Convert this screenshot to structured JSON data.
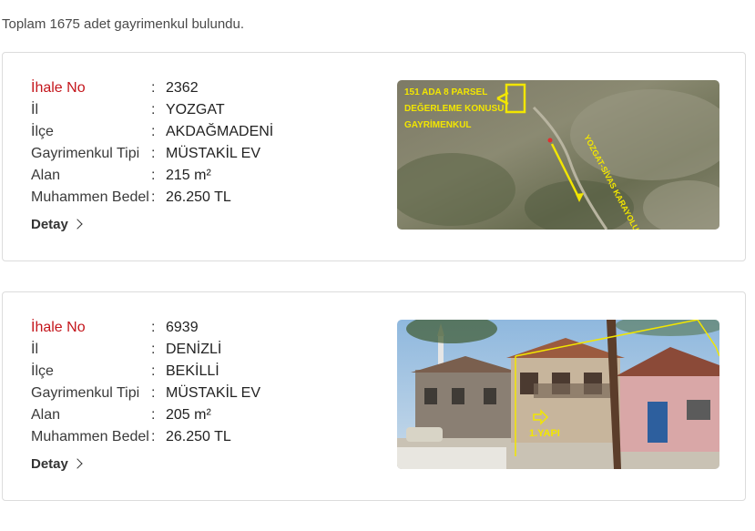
{
  "summary": "Toplam 1675 adet gayrimenkul bulundu.",
  "labels": {
    "ihale_no": "İhale No",
    "il": "İl",
    "ilce": "İlçe",
    "tip": "Gayrimenkul Tipi",
    "alan": "Alan",
    "bedel": "Muhammen Bedel",
    "colon": ":",
    "detail": "Detay"
  },
  "listings": [
    {
      "ihale_no": "2362",
      "il": "YOZGAT",
      "ilce": "AKDAĞMADENİ",
      "tip": "MÜSTAKİL EV",
      "alan": "215 m²",
      "bedel": "26.250 TL",
      "photo_text": [
        "151 ADA 8 PARSEL",
        "DEĞERLEME KONUSU",
        "GAYRİMENKUL",
        "YOZGAT-SİVAS KARAYOLU"
      ]
    },
    {
      "ihale_no": "6939",
      "il": "DENİZLİ",
      "ilce": "BEKİLLİ",
      "tip": "MÜSTAKİL EV",
      "alan": "205 m²",
      "bedel": "26.250 TL",
      "photo_text": [
        "1.YAPI"
      ]
    }
  ],
  "colors": {
    "accent_red": "#c4161c",
    "annotation_yellow": "#f2e600"
  }
}
